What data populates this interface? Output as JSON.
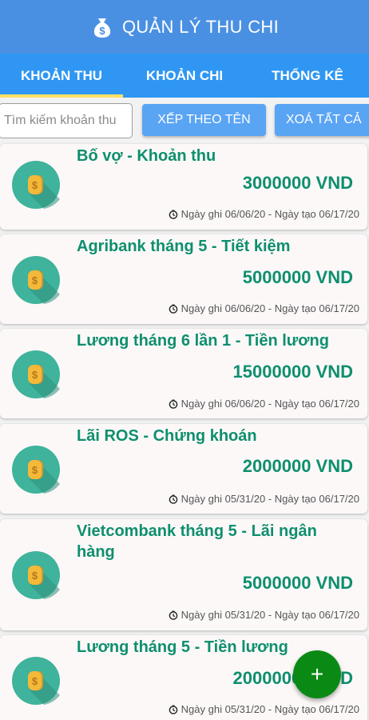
{
  "app": {
    "title": "QUẢN LÝ THU CHI",
    "icon": "money-bag-icon"
  },
  "tabs": [
    {
      "label": "KHOẢN THU",
      "active": true
    },
    {
      "label": "KHOẢN CHI",
      "active": false
    },
    {
      "label": "THỐNG KÊ",
      "active": false
    }
  ],
  "toolbar": {
    "search_placeholder": "Tìm kiếm khoản thu",
    "sort_label": "XẾP THEO TÊN",
    "clear_label": "XOÁ TẤT CẢ"
  },
  "items": [
    {
      "title": "Bố vợ - Khoản thu",
      "amount": "3000000 VND",
      "meta": "Ngày ghi 06/06/20 - Ngày tạo 06/17/20"
    },
    {
      "title": "Agribank tháng 5 - Tiết kiệm",
      "amount": "5000000 VND",
      "meta": "Ngày ghi 06/06/20 - Ngày tạo 06/17/20"
    },
    {
      "title": "Lương tháng 6 lần 1 - Tiền lương",
      "amount": "15000000 VND",
      "meta": "Ngày ghi 06/06/20 - Ngày tạo 06/17/20"
    },
    {
      "title": "Lãi ROS  - Chứng khoán",
      "amount": "2000000 VND",
      "meta": "Ngày ghi 05/31/20 - Ngày tạo 06/17/20"
    },
    {
      "title": "Vietcombank tháng 5 - Lãi ngân hàng",
      "amount": "5000000 VND",
      "meta": "Ngày ghi 05/31/20 - Ngày tạo 06/17/20"
    },
    {
      "title": "Lương tháng 5 - Tiền lương",
      "amount": "20000000 VND",
      "meta": "Ngày ghi 05/31/20 - Ngày tạo 06/17/20"
    }
  ],
  "fab": {
    "label": "+"
  },
  "colors": {
    "appbar": "#4a90e2",
    "tabs": "#2f97f3",
    "accent_text": "#0e8f6e",
    "fab": "#0a8a15",
    "coin_bg": "#3fb39b",
    "coin": "#f5b93a"
  }
}
